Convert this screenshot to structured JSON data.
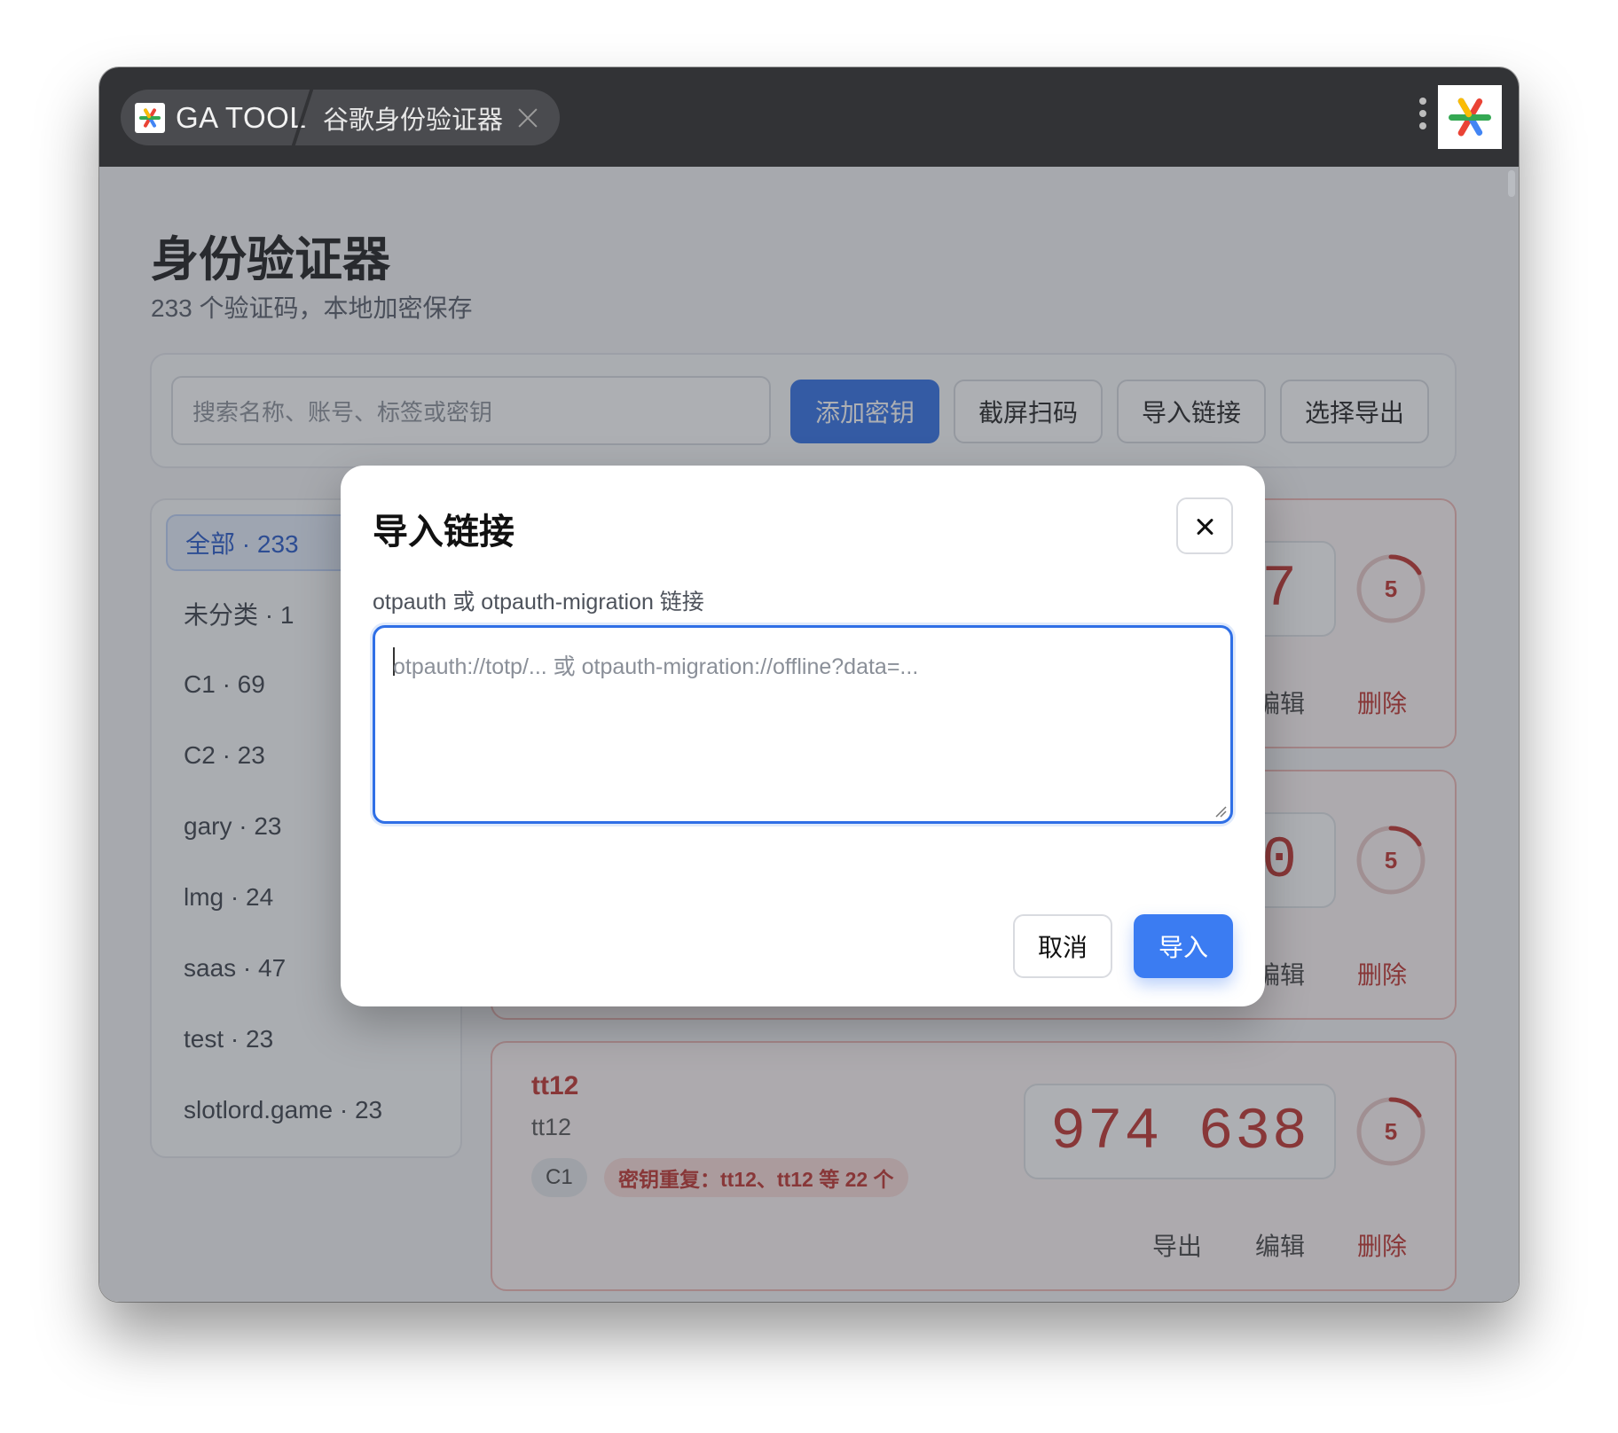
{
  "titlebar": {
    "app_name": "GA TOOL",
    "page_tab": "谷歌身份验证器"
  },
  "header": {
    "title": "身份验证器",
    "subtitle": "233 个验证码，本地加密保存"
  },
  "toolbar": {
    "search_placeholder": "搜索名称、账号、标签或密钥",
    "add_key": "添加密钥",
    "scan_screen": "截屏扫码",
    "import_link": "导入链接",
    "select_export": "选择导出"
  },
  "sidebar": {
    "items": [
      {
        "label": "全部 · 233",
        "active": true
      },
      {
        "label": "未分类 · 1"
      },
      {
        "label": "C1 · 69"
      },
      {
        "label": "C2 · 23"
      },
      {
        "label": "gary · 23"
      },
      {
        "label": "lmg · 24"
      },
      {
        "label": "saas · 47"
      },
      {
        "label": "test · 23"
      },
      {
        "label": "slotlord.game · 23"
      }
    ]
  },
  "cards": [
    {
      "code_visible": "7",
      "timer": "5",
      "edit": "编辑",
      "delete": "删除"
    },
    {
      "code_visible": "0",
      "timer": "5",
      "edit": "编辑",
      "delete": "删除"
    },
    {
      "name": "tt12",
      "account": "tt12",
      "tag": "C1",
      "warning": "密钥重复：tt12、tt12 等 22 个",
      "code": "974 638",
      "timer": "5",
      "export": "导出",
      "edit": "编辑",
      "delete": "删除"
    }
  ],
  "modal": {
    "title": "导入链接",
    "label": "otpauth 或 otpauth-migration 链接",
    "placeholder": "otpauth://totp/... 或 otpauth-migration://offline?data=...",
    "cancel": "取消",
    "confirm": "导入"
  },
  "colors": {
    "primary": "#2f6fe6",
    "danger": "#c0312b",
    "titlebar": "#323336"
  }
}
